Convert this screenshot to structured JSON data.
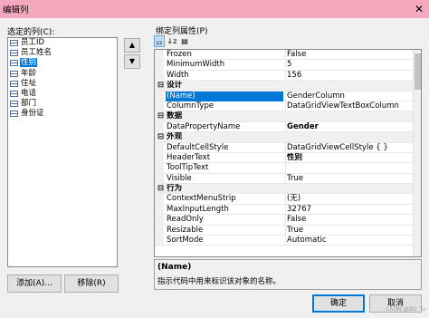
{
  "window": {
    "title": "编辑列",
    "close_glyph": "✕"
  },
  "left": {
    "label": "选定的列(C):",
    "columns": [
      {
        "label": "员工ID",
        "selected": false
      },
      {
        "label": "员工姓名",
        "selected": false
      },
      {
        "label": "性别",
        "selected": true
      },
      {
        "label": "年龄",
        "selected": false
      },
      {
        "label": "住址",
        "selected": false
      },
      {
        "label": "电话",
        "selected": false
      },
      {
        "label": "部门",
        "selected": false
      },
      {
        "label": "身份证",
        "selected": false
      }
    ],
    "move_up_glyph": "▲",
    "move_down_glyph": "▼",
    "add_button": "添加(A)...",
    "remove_button": "移除(R)"
  },
  "right": {
    "label": "绑定列属性(P)",
    "toolbar": {
      "categorized_glyph": "⚏",
      "alphabetical_glyph": "↓z",
      "pages_glyph": "▤"
    },
    "rows": [
      {
        "type": "prop",
        "name": "Frozen",
        "value": "False"
      },
      {
        "type": "prop",
        "name": "MinimumWidth",
        "value": "5"
      },
      {
        "type": "prop",
        "name": "Width",
        "value": "156"
      },
      {
        "type": "cat",
        "name": "设计",
        "collapse": "⊟"
      },
      {
        "type": "prop",
        "name": "(Name)",
        "value": "GenderColumn"
      },
      {
        "type": "prop",
        "name": "ColumnType",
        "value": "DataGridViewTextBoxColumn"
      },
      {
        "type": "cat",
        "name": "数据",
        "collapse": "⊟"
      },
      {
        "type": "prop",
        "name": "DataPropertyName",
        "value": "Gender",
        "bold": true
      },
      {
        "type": "cat",
        "name": "外观",
        "collapse": "⊟"
      },
      {
        "type": "prop",
        "name": "DefaultCellStyle",
        "value": "DataGridViewCellStyle { }"
      },
      {
        "type": "prop",
        "name": "HeaderText",
        "value": "性别",
        "bold": true
      },
      {
        "type": "prop",
        "name": "ToolTipText",
        "value": ""
      },
      {
        "type": "prop",
        "name": "Visible",
        "value": "True"
      },
      {
        "type": "cat",
        "name": "行为",
        "collapse": "⊟"
      },
      {
        "type": "prop",
        "name": "ContextMenuStrip",
        "value": "(无)"
      },
      {
        "type": "prop",
        "name": "MaxInputLength",
        "value": "32767"
      },
      {
        "type": "prop",
        "name": "ReadOnly",
        "value": "False"
      },
      {
        "type": "prop",
        "name": "Resizable",
        "value": "True"
      },
      {
        "type": "prop",
        "name": "SortMode",
        "value": "Automatic"
      }
    ],
    "description": {
      "title": "(Name)",
      "text": "指示代码中用来标识该对象的名称。"
    }
  },
  "footer": {
    "ok_button": "确定",
    "cancel_button": "取消"
  },
  "watermark": "CSDN @Wz_Tu"
}
